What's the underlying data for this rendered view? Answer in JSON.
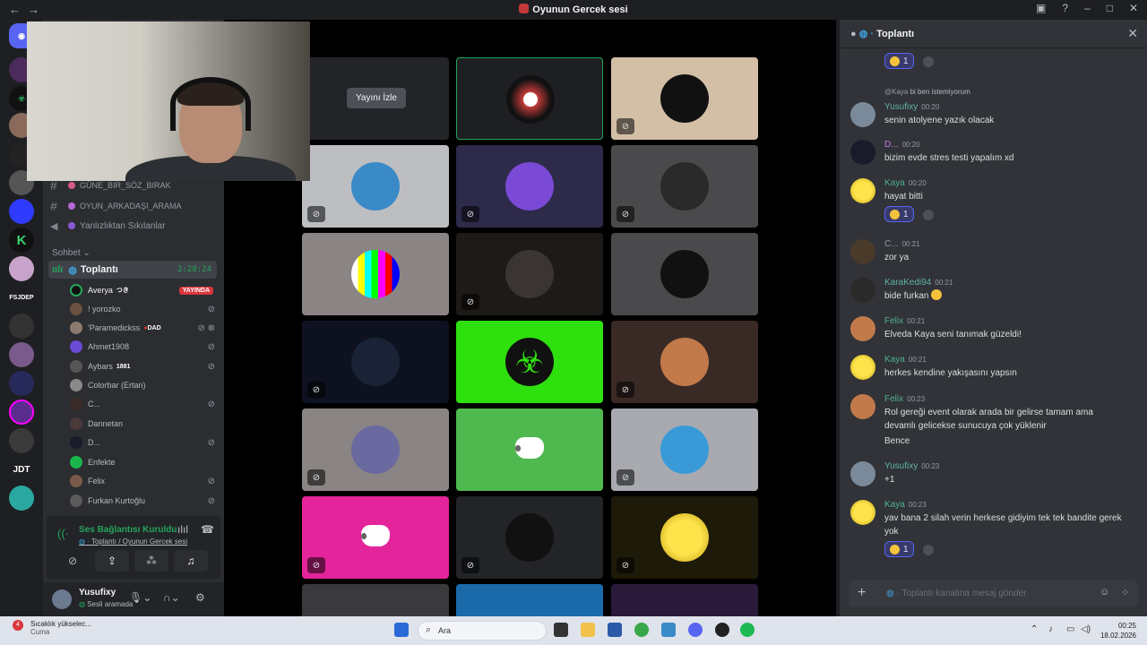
{
  "window": {
    "title": "Oyunun Gercek sesi"
  },
  "sidebar": {
    "channels": [
      {
        "name": "GÜNE_BIR_SÖZ_BIRAK"
      },
      {
        "name": "OYUN_ARKADAŞI_ARAMA"
      },
      {
        "name": "Yanlızlıktan Sıkılanlar"
      }
    ],
    "category": "Sohbet",
    "voice_channel": {
      "name": "Toplantı",
      "timer": "2:28:24"
    },
    "members": [
      {
        "name": "Averya",
        "extra": "つき",
        "badge": "YAYINDA"
      },
      {
        "name": "! yorozko"
      },
      {
        "name": "'Paramedickss",
        "tag": "DAD"
      },
      {
        "name": "Ahmet1908"
      },
      {
        "name": "Aybars",
        "tag": "1881"
      },
      {
        "name": "Colorbar (Ertan)"
      },
      {
        "name": "C..."
      },
      {
        "name": "Dannetan"
      },
      {
        "name": "D..."
      },
      {
        "name": "Enfekte"
      },
      {
        "name": "Felix"
      },
      {
        "name": "Furkan Kurtoğlu"
      }
    ],
    "voice_status": {
      "connected": "Ses Bağlantısı Kuruldu",
      "location": "Toplantı / Oyunun Gercek sesi"
    },
    "user": {
      "name": "Yusufixy",
      "status": "Sesli aramada"
    },
    "server_labels": [
      "FSJDEP",
      "JDT"
    ]
  },
  "stage": {
    "watch_button": "Yayını İzle"
  },
  "chat": {
    "channel": "Toplantı",
    "top_reaction_count": "1",
    "reply_preview": {
      "user": "@Kaya",
      "text": "bi ben istemiyorum"
    },
    "messages": [
      {
        "user": "Yusufixy",
        "time": "00:20",
        "color": "#5fb3a0",
        "text": "senin atolyene yazık olacak"
      },
      {
        "user": "D...",
        "time": "00:20",
        "color": "#c27ee0",
        "text": "bizim evde stres testi yapalım xd"
      },
      {
        "user": "Kaya",
        "time": "00:20",
        "color": "#4fb08f",
        "text": "hayat bitti",
        "reaction": "1"
      },
      {
        "user": "C...",
        "time": "00:21",
        "color": "#949ba4",
        "text": "zor ya"
      },
      {
        "user": "KaraKedi94",
        "time": "00:21",
        "color": "#5fb3a0",
        "text": "bide furkan"
      },
      {
        "user": "Felix",
        "time": "00:21",
        "color": "#4fb08f",
        "text": "Elveda Kaya seni tanımak güzeldi!"
      },
      {
        "user": "Kaya",
        "time": "00:21",
        "color": "#4fb08f",
        "text": "herkes kendine yakışasını yapsın"
      },
      {
        "user": "Felix",
        "time": "00:23",
        "color": "#4fb08f",
        "text": "Rol gereği event olarak arada bir gelirse tamam ama devamlı gelicekse sunucuya çok yüklenir",
        "text2": "Bence"
      },
      {
        "user": "Yusufixy",
        "time": "00:23",
        "color": "#5fb3a0",
        "text": "+1"
      },
      {
        "user": "Kaya",
        "time": "00:23",
        "color": "#4fb08f",
        "text": "yav bana 2 silah verin herkese gidiyim tek tek bandite gerek yok",
        "reaction": "1"
      }
    ],
    "composer_placeholder": "Toplantı kanalına mesaj gönder"
  },
  "taskbar": {
    "weather_title": "Sıcaklık yükselec...",
    "weather_sub": "Cuma",
    "weather_badge": "4",
    "search_placeholder": "Ara",
    "time": "00:25",
    "date": "18.02.2026"
  },
  "colors": {
    "accent": "#5865f2",
    "online": "#23a55a",
    "live": "#da373c"
  }
}
